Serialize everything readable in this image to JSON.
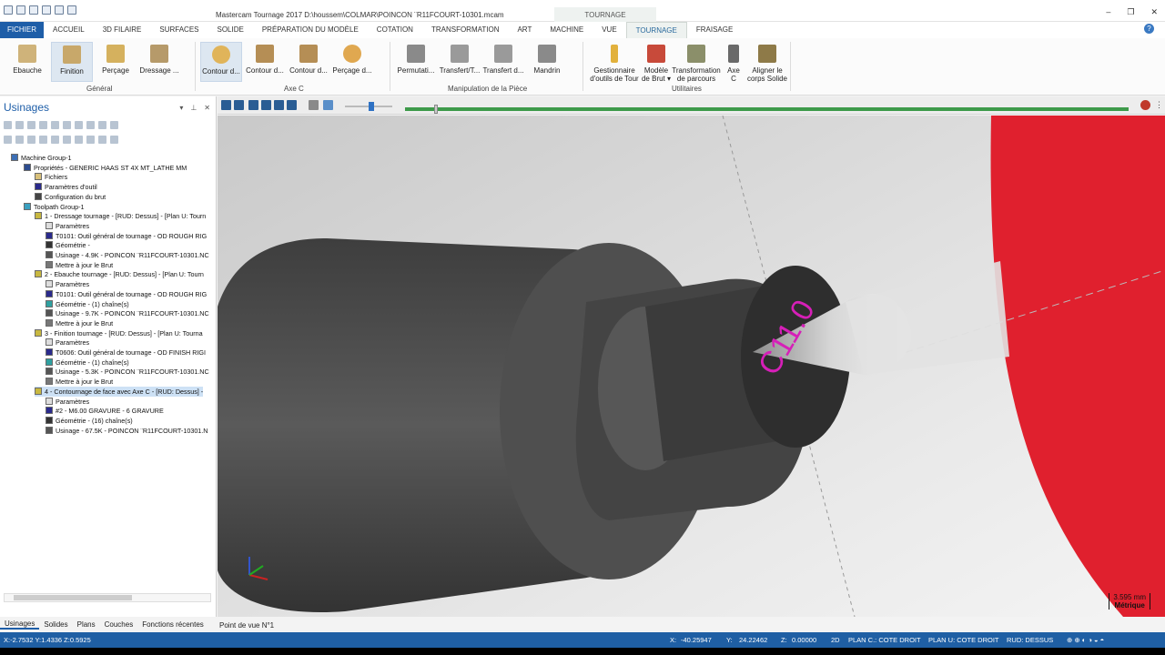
{
  "window": {
    "title": "Mastercam Tournage 2017  D:\\houssem\\COLMAR\\POINCON ¨R11FCOURT-10301.mcam",
    "context_tab": "TOURNAGE"
  },
  "ribbon": {
    "tabs": [
      "FICHIER",
      "ACCUEIL",
      "3D FILAIRE",
      "SURFACES",
      "SOLIDE",
      "PRÉPARATION DU MODÈLE",
      "COTATION",
      "TRANSFORMATION",
      "ART",
      "MACHINE",
      "VUE",
      "TOURNAGE",
      "FRAISAGE"
    ],
    "groups": [
      "Général",
      "Axe C",
      "Manipulation de la Pièce",
      "Utilitaires"
    ],
    "buttons": [
      "Ebauche",
      "Finition",
      "Perçage",
      "Dressage ...",
      "Contour d...",
      "Contour d...",
      "Contour d...",
      "Perçage d...",
      "Permutati...",
      "Transfert/T...",
      "Transfert d...",
      "Mandrin"
    ],
    "util_buttons": [
      [
        "Gestionnaire",
        "d'outils de Tour"
      ],
      [
        "Modèle",
        "de Brut ▾"
      ],
      [
        "Transformation",
        "de parcours"
      ],
      [
        "Axe",
        "C"
      ],
      [
        "Aligner le",
        "corps Solide"
      ]
    ]
  },
  "panel": {
    "title": "Usinages",
    "tree": [
      {
        "t": "Machine Group-1",
        "x": 0,
        "ic": "#3d6fb5"
      },
      {
        "t": "Propriétés - GENERIC HAAS ST 4X MT_LATHE MM",
        "x": 14,
        "ic": "#2d4c8f"
      },
      {
        "t": "Fichiers",
        "x": 26,
        "ic": "#d8c07a"
      },
      {
        "t": "Paramètres d'outil",
        "x": 26,
        "ic": "#2a2a8c"
      },
      {
        "t": "Configuration du brut",
        "x": 26,
        "ic": "#444"
      },
      {
        "t": "Toolpath Group-1",
        "x": 14,
        "ic": "#3aa0c0"
      },
      {
        "t": "1 - Dressage tournage - [RUD: Dessus] - [Plan U: Tourn",
        "x": 26,
        "ic": "#c8b840"
      },
      {
        "t": "Paramètres",
        "x": 38,
        "ic": "#ddd"
      },
      {
        "t": "T0101: Outil général de tournage - OD ROUGH RIG",
        "x": 38,
        "ic": "#2a2a8c"
      },
      {
        "t": "Géométrie -",
        "x": 38,
        "ic": "#333"
      },
      {
        "t": "Usinage - 4.9K - POINCON ¨R11FCOURT-10301.NC",
        "x": 38,
        "ic": "#555"
      },
      {
        "t": "Mettre à jour le Brut",
        "x": 38,
        "ic": "#777"
      },
      {
        "t": "2 - Ebauche tournage - [RUD: Dessus] - [Plan U: Tourn",
        "x": 26,
        "ic": "#c8b840"
      },
      {
        "t": "Paramètres",
        "x": 38,
        "ic": "#ddd"
      },
      {
        "t": "T0101: Outil général de tournage - OD ROUGH RIG",
        "x": 38,
        "ic": "#2a2a8c"
      },
      {
        "t": "Géométrie -  (1) chaîne(s)",
        "x": 38,
        "ic": "#2fa0a0"
      },
      {
        "t": "Usinage - 9.7K - POINCON ¨R11FCOURT-10301.NC",
        "x": 38,
        "ic": "#555"
      },
      {
        "t": "Mettre à jour le Brut",
        "x": 38,
        "ic": "#777"
      },
      {
        "t": "3 - Finition tournage - [RUD: Dessus] - [Plan U: Tourna",
        "x": 26,
        "ic": "#c8b840"
      },
      {
        "t": "Paramètres",
        "x": 38,
        "ic": "#ddd"
      },
      {
        "t": "T0606: Outil général de tournage - OD FINISH RIGI",
        "x": 38,
        "ic": "#2a2a8c"
      },
      {
        "t": "Géométrie -  (1) chaîne(s)",
        "x": 38,
        "ic": "#2fa0a0"
      },
      {
        "t": "Usinage - 5.3K - POINCON ¨R11FCOURT-10301.NC",
        "x": 38,
        "ic": "#555"
      },
      {
        "t": "Mettre à jour le Brut",
        "x": 38,
        "ic": "#777"
      },
      {
        "t": "4 - Contournage de face avec Axe C - [RUD: Dessus] -",
        "x": 26,
        "ic": "#c8b840",
        "sel": true
      },
      {
        "t": "Paramètres",
        "x": 38,
        "ic": "#ddd"
      },
      {
        "t": "#2 - M6.00 GRAVURE - 6 GRAVURE",
        "x": 38,
        "ic": "#2a2a8c"
      },
      {
        "t": "Géométrie -  (16) chaîne(s)",
        "x": 38,
        "ic": "#333"
      },
      {
        "t": "Usinage - 67.5K - POINCON ¨R11FCOURT-10301.N",
        "x": 38,
        "ic": "#555"
      }
    ]
  },
  "bottom_tabs": [
    "Usinages",
    "Solides",
    "Plans",
    "Couches",
    "Fonctions récentes"
  ],
  "viewport": {
    "tab": "Point de vue N°1",
    "engraving": "C11.0",
    "scale_value": "3.595 mm",
    "scale_unit": "Métrique"
  },
  "status": {
    "left": "X:-2.7532  Y:1.4336  Z:0.5925",
    "x_label": "X:",
    "x": "-40.25947",
    "y_label": "Y:",
    "y": "24.22462",
    "z_label": "Z:",
    "z": "0.00000",
    "mode": "2D",
    "plan_c": "PLAN C.: COTE DROIT",
    "plan_u": "PLAN U: COTE DROIT",
    "rud": "RUD: DESSUS"
  }
}
